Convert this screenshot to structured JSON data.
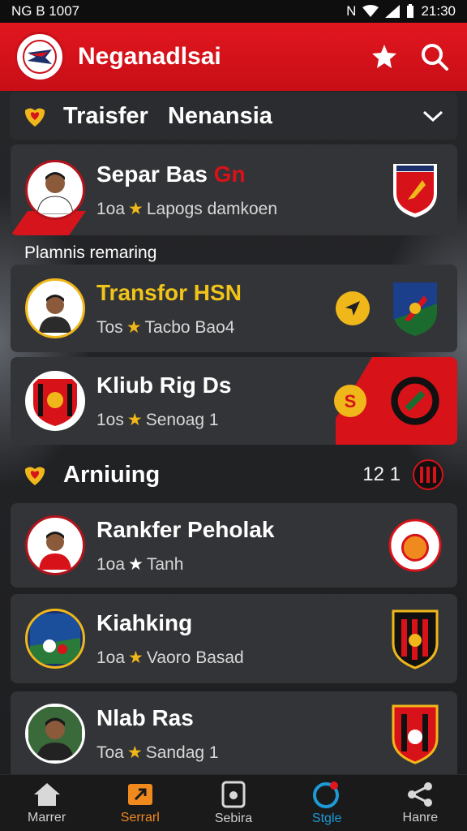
{
  "status_bar": {
    "left": "ᴺᴼ⁸ ¹⁰⁰⁷",
    "left_text": "NG B 1007",
    "time": "21:30"
  },
  "app_bar": {
    "title": "Neganadlsai"
  },
  "section1": {
    "title": "Traisfer   Nenansia"
  },
  "cards": [
    {
      "title": "Separ Bas",
      "title_suffix": "Gn",
      "sub_prefix": "1oa",
      "sub": "Lapogs damkoen"
    },
    {
      "title": "Transfor HSN",
      "sub_prefix": "Tos",
      "sub": "Tacbo Bao4"
    },
    {
      "title": "Kliub Rig Ds",
      "sub_prefix": "1os",
      "sub": "Senoag 1"
    },
    {
      "title": "Rankfer Peholak",
      "sub_prefix": "1oa",
      "sub": "Tanh"
    },
    {
      "title": "Kiahking",
      "sub_prefix": "1oa",
      "sub": "Vaoro Basad"
    },
    {
      "title": "Nlab Ras",
      "sub_prefix": "Toa",
      "sub": "Sandag 1"
    }
  ],
  "label_between": "Plamnis remaring",
  "section2": {
    "title": "Arniuing",
    "score": "12 1"
  },
  "nav": [
    {
      "label": "Marrer"
    },
    {
      "label": "Serrarl"
    },
    {
      "label": "Sebira"
    },
    {
      "label": "Stgle"
    },
    {
      "label": "Hanre"
    }
  ],
  "colors": {
    "brand_red": "#d71219",
    "accent_yellow": "#f0b71a",
    "card_bg": "#333437",
    "nav_blue": "#1e9ad6",
    "nav_orange": "#f08a1e"
  }
}
